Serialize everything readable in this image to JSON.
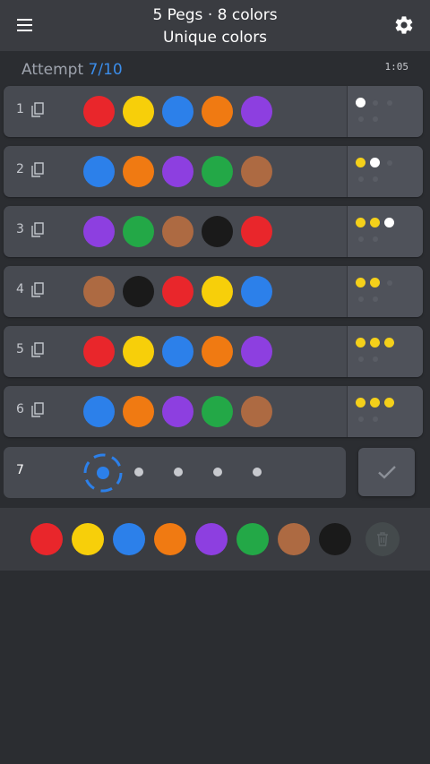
{
  "header": {
    "title_line1": "5 Pegs · 8 colors",
    "title_line2": "Unique colors",
    "menu_icon": "hamburger-menu-icon",
    "settings_icon": "gear-icon"
  },
  "status": {
    "attempt_prefix": "Attempt",
    "attempt_value": "7/10",
    "timer": "1:05"
  },
  "colors": {
    "red": "#e9262b",
    "yellow": "#f7cf0a",
    "blue": "#2c80ea",
    "orange": "#f07a12",
    "purple": "#8d3fe0",
    "green": "#23a847",
    "brown": "#ad6a42",
    "black": "#1a1a1a"
  },
  "rows": [
    {
      "num": "1",
      "pegs": [
        "red",
        "yellow",
        "blue",
        "orange",
        "purple"
      ],
      "feedback": [
        "white"
      ]
    },
    {
      "num": "2",
      "pegs": [
        "blue",
        "orange",
        "purple",
        "green",
        "brown"
      ],
      "feedback": [
        "yellow",
        "white"
      ]
    },
    {
      "num": "3",
      "pegs": [
        "purple",
        "green",
        "brown",
        "black",
        "red"
      ],
      "feedback": [
        "yellow",
        "yellow",
        "white"
      ]
    },
    {
      "num": "4",
      "pegs": [
        "brown",
        "black",
        "red",
        "yellow",
        "blue"
      ],
      "feedback": [
        "yellow",
        "yellow"
      ]
    },
    {
      "num": "5",
      "pegs": [
        "red",
        "yellow",
        "blue",
        "orange",
        "purple"
      ],
      "feedback": [
        "yellow",
        "yellow",
        "yellow"
      ]
    },
    {
      "num": "6",
      "pegs": [
        "blue",
        "orange",
        "purple",
        "green",
        "brown"
      ],
      "feedback": [
        "yellow",
        "yellow",
        "yellow"
      ]
    }
  ],
  "current": {
    "num": "7",
    "active_slot": 0,
    "slots": 5
  },
  "palette": [
    "red",
    "yellow",
    "blue",
    "orange",
    "purple",
    "green",
    "brown",
    "black"
  ],
  "icons": {
    "copy": "copy-icon",
    "submit": "checkmark-icon",
    "delete": "trash-icon"
  }
}
